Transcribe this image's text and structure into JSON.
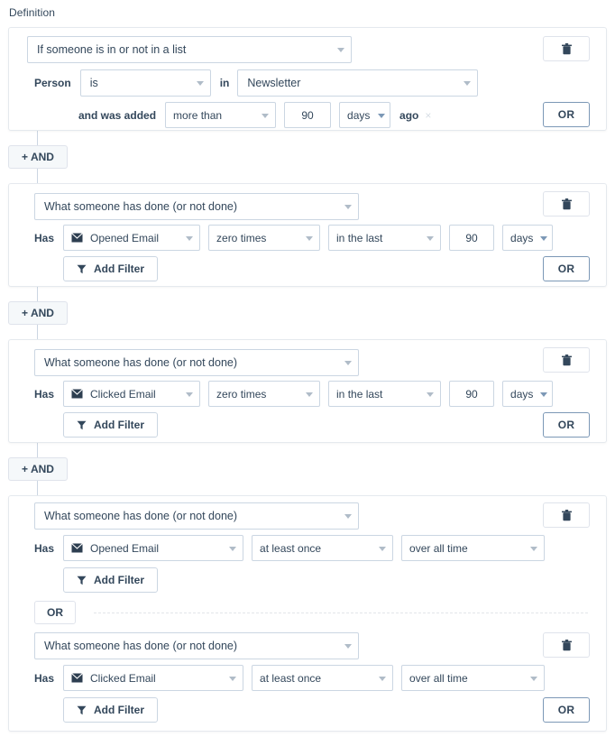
{
  "page": {
    "section_label": "Definition",
    "accent_border": "#7c98b6",
    "control_border": "#cbd6e2",
    "text_color": "#33475b"
  },
  "buttons": {
    "and_label": "+ AND",
    "or_label": "OR",
    "add_filter_label": "Add Filter",
    "trash_icon": "trash-icon",
    "funnel_icon": "funnel-icon",
    "mail_icon": "mail-event-icon",
    "remove_x": "×"
  },
  "groups": [
    {
      "id": "group-1",
      "type_select": "If someone is in or not in a list",
      "rows": [
        {
          "label": "Person",
          "operator": "is",
          "joiner": "in",
          "list_value": "Newsletter"
        },
        {
          "label": "and was added",
          "comparator": "more than",
          "amount": "90",
          "unit": "days",
          "suffix": "ago"
        }
      ]
    },
    {
      "id": "group-2",
      "type_select": "What someone has done (or not done)",
      "rows": [
        {
          "label": "Has",
          "event": "Opened Email",
          "frequency": "zero times",
          "timeframe": "in the last",
          "amount": "90",
          "unit": "days"
        }
      ]
    },
    {
      "id": "group-3",
      "type_select": "What someone has done (or not done)",
      "rows": [
        {
          "label": "Has",
          "event": "Clicked Email",
          "frequency": "zero times",
          "timeframe": "in the last",
          "amount": "90",
          "unit": "days"
        }
      ]
    },
    {
      "id": "group-4",
      "type_select_a": "What someone has done (or not done)",
      "type_select_b": "What someone has done (or not done)",
      "divider_label": "OR",
      "rows": [
        {
          "label": "Has",
          "event": "Opened Email",
          "frequency": "at least once",
          "timeframe": "over all time"
        },
        {
          "label": "Has",
          "event": "Clicked Email",
          "frequency": "at least once",
          "timeframe": "over all time"
        }
      ]
    }
  ]
}
